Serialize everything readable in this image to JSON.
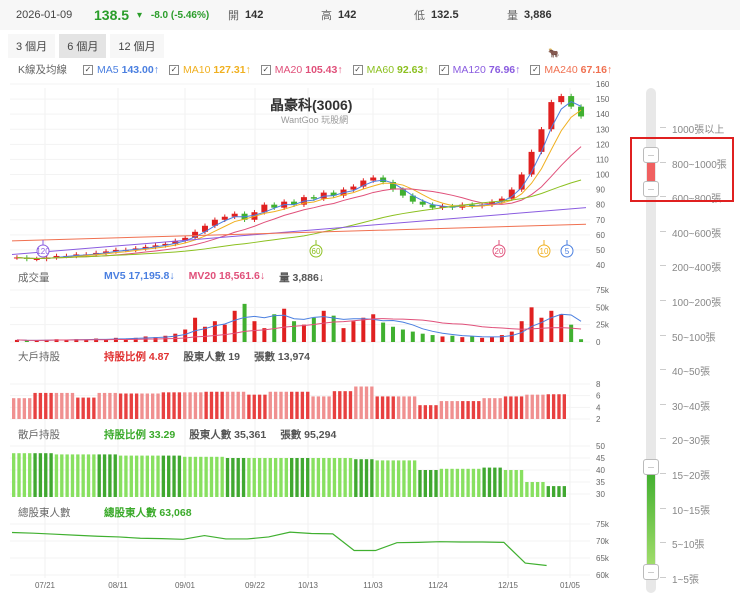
{
  "header": {
    "date": "2026-01-09",
    "price": "138.5",
    "change": "-8.0 (-5.46%)",
    "open_label": "開",
    "open": "142",
    "high_label": "高",
    "high": "142",
    "low_label": "低",
    "low": "132.5",
    "vol_label": "量",
    "vol": "3,886"
  },
  "tabs": [
    {
      "label": "3 個月"
    },
    {
      "label": "6 個月",
      "active": true
    },
    {
      "label": "12 個月"
    }
  ],
  "ma_legend": {
    "title": "K線及均線",
    "items": [
      {
        "name": "MA5",
        "value": "143.00↑",
        "color": "#4a7fe0"
      },
      {
        "name": "MA10",
        "value": "127.31↑",
        "color": "#f0b020"
      },
      {
        "name": "MA20",
        "value": "105.43↑",
        "color": "#e0507a"
      },
      {
        "name": "MA60",
        "value": "92.63↑",
        "color": "#8cc020"
      },
      {
        "name": "MA120",
        "value": "76.96↑",
        "color": "#8a5ce0"
      },
      {
        "name": "MA240",
        "value": "67.16↑",
        "color": "#f07050"
      }
    ]
  },
  "logo_text": "玩股網",
  "chart_title": "晶豪科(3006)",
  "chart_subtitle": "WantGoo 玩股網",
  "volume": {
    "title": "成交量",
    "mv5": "MV5 17,195.8↓",
    "mv20": "MV20 18,561.6↓",
    "vol": "量 3,886↓"
  },
  "big": {
    "title": "大戶持股",
    "ratio": "持股比例 4.87",
    "holders": "股東人數 19",
    "shares": "張數 13,974"
  },
  "retail": {
    "title": "散戶持股",
    "ratio": "持股比例 33.29",
    "holders": "股東人數 35,361",
    "shares": "張數 95,294"
  },
  "total": {
    "title": "總股東人數",
    "count": "總股東人數 63,068"
  },
  "markers": [
    "120",
    "60",
    "20",
    "10",
    "5"
  ],
  "x_labels": [
    "07/21",
    "08/11",
    "09/01",
    "09/22",
    "10/13",
    "11/03",
    "11/24",
    "12/15",
    "01/05"
  ],
  "axes": {
    "price": [
      "160",
      "150",
      "140",
      "130",
      "120",
      "110",
      "100",
      "90",
      "80",
      "70",
      "60",
      "50",
      "40"
    ],
    "volume": [
      "75k",
      "50k",
      "25k",
      "0"
    ],
    "big": [
      "8",
      "6",
      "4",
      "2"
    ],
    "retail": [
      "50",
      "45",
      "40",
      "35",
      "30"
    ],
    "total": [
      "75k",
      "70k",
      "65k",
      "60k"
    ]
  },
  "slider": {
    "labels": [
      "1000張以上",
      "800~1000張",
      "600~800張",
      "400~600張",
      "200~400張",
      "100~200張",
      "50~100張",
      "40~50張",
      "30~40張",
      "20~30張",
      "15~20張",
      "10~15張",
      "5~10張",
      "1~5張"
    ],
    "big_range": [
      "600~800張",
      "800~1000張"
    ],
    "retail_range": [
      "1~5張",
      "15~20張"
    ]
  },
  "chart_data": {
    "type": "candlestick",
    "closes": [
      45,
      44,
      44,
      45,
      46,
      46,
      47,
      47,
      48,
      49,
      50,
      50,
      51,
      52,
      53,
      54,
      56,
      58,
      62,
      66,
      70,
      72,
      74,
      70,
      75,
      80,
      78,
      82,
      80,
      85,
      84,
      88,
      86,
      90,
      92,
      96,
      98,
      95,
      90,
      86,
      82,
      80,
      78,
      79,
      78,
      80,
      79,
      80,
      82,
      84,
      90,
      100,
      115,
      130,
      148,
      152,
      145,
      138.5
    ],
    "volume_k": [
      3,
      2,
      2,
      3,
      4,
      3,
      4,
      3,
      5,
      4,
      6,
      5,
      6,
      8,
      7,
      9,
      12,
      18,
      35,
      22,
      30,
      25,
      45,
      55,
      30,
      20,
      40,
      48,
      30,
      25,
      35,
      45,
      38,
      20,
      30,
      35,
      40,
      28,
      22,
      18,
      15,
      12,
      10,
      8,
      9,
      7,
      8,
      6,
      7,
      10,
      15,
      30,
      50,
      35,
      45,
      40,
      25,
      4
    ],
    "big_ratio": [
      4.2,
      5.1,
      5.1,
      4.3,
      5.1,
      5,
      5,
      5.2,
      5.2,
      5.3,
      5.3,
      4.8,
      5.3,
      5.3,
      4.5,
      5.4,
      6.2,
      4.5,
      4.5,
      3,
      3.7,
      3.7,
      4.2,
      4.5,
      4.8,
      4.87
    ],
    "retail_ratio": [
      47,
      47,
      46.5,
      46.5,
      46.5,
      46,
      46,
      46,
      45.5,
      45.5,
      45,
      45,
      45,
      45,
      45,
      45,
      44.5,
      44,
      44,
      40,
      40.5,
      40.5,
      41,
      40,
      35,
      33.29
    ],
    "total_holders_k": [
      72.5,
      72.3,
      72,
      71.7,
      71.4,
      71.2,
      70.8,
      70.7,
      70.5,
      71.6,
      70.6,
      70.6,
      71.2,
      72.6,
      72.2,
      72.1,
      67.2,
      67.2,
      69.5,
      69.6,
      69.8,
      69.7,
      69.7,
      69.6,
      63.5,
      62.8
    ]
  }
}
